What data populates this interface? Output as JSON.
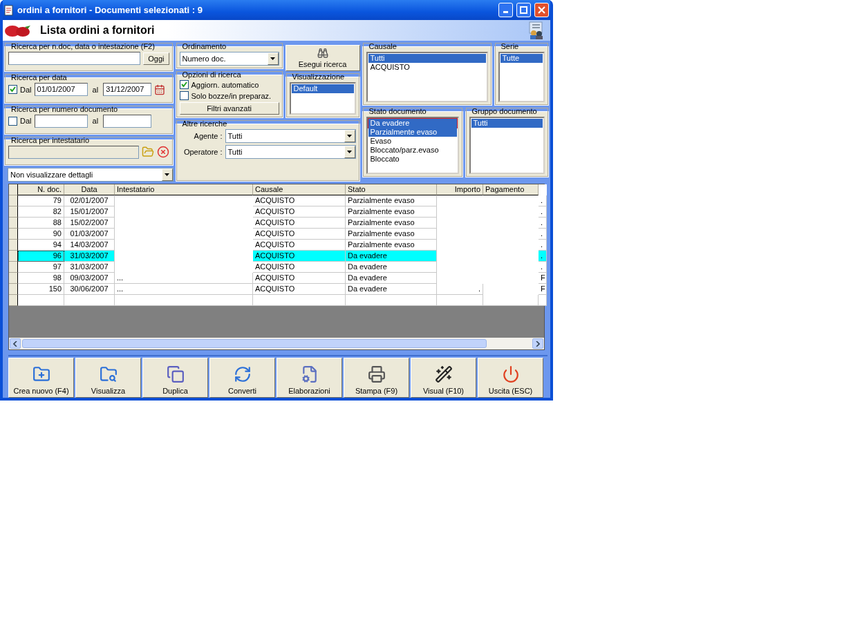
{
  "window": {
    "title": "ordini a fornitori - Documenti selezionati : 9"
  },
  "header": {
    "title": "Lista ordini a fornitori"
  },
  "text_search": {
    "label": "Ricerca per n.doc, data o intestazione (F2)",
    "button": "Oggi"
  },
  "date_search": {
    "label": "Ricerca per data",
    "checked": true,
    "from_label": "Dal",
    "from": "01/01/2007",
    "to_label": "al",
    "to": "31/12/2007"
  },
  "number_search": {
    "label": "Ricerca per numero documento",
    "checked": false,
    "from_label": "Dal",
    "to_label": "al"
  },
  "holder_search": {
    "label": "Ricerca per intestatario"
  },
  "details_select": {
    "value": "Non visualizzare dettagli"
  },
  "ordering": {
    "label": "Ordinamento",
    "value": "Numero doc."
  },
  "search_options": {
    "label": "Opzioni di ricerca",
    "items": [
      {
        "label": "Aggiorn. automatico",
        "checked": true
      },
      {
        "label": "Solo bozze/in preparaz.",
        "checked": false
      }
    ],
    "button": "Filtri avanzati"
  },
  "search_button": "Esegui ricerca",
  "display": {
    "label": "Visualizzazione",
    "items": [
      {
        "label": "Default",
        "selected": true
      }
    ]
  },
  "other_searches": {
    "label": "Altre ricerche",
    "fields": [
      {
        "label": "Agente :",
        "value": "Tutti"
      },
      {
        "label": "Operatore :",
        "value": "Tutti"
      }
    ]
  },
  "causale": {
    "label": "Causale",
    "items": [
      {
        "label": "Tutti",
        "selected": true
      },
      {
        "label": "ACQUISTO",
        "selected": false
      }
    ]
  },
  "serie": {
    "label": "Serie",
    "items": [
      {
        "label": "Tutte",
        "selected": true
      }
    ]
  },
  "document_state": {
    "label": "Stato documento",
    "items": [
      {
        "label": "Da evadere",
        "selected": true,
        "outlined": true
      },
      {
        "label": "Parzialmente evaso",
        "selected": true,
        "outlined": false
      },
      {
        "label": "Evaso",
        "selected": false,
        "outlined": false
      },
      {
        "label": "Bloccato/parz.evaso",
        "selected": false,
        "outlined": false
      },
      {
        "label": "Bloccato",
        "selected": false,
        "outlined": false
      }
    ]
  },
  "document_group": {
    "label": "Gruppo documento",
    "items": [
      {
        "label": "Tutti",
        "selected": true
      }
    ]
  },
  "table": {
    "columns": [
      {
        "label": "N. doc."
      },
      {
        "label": "Data"
      },
      {
        "label": "Intestatario"
      },
      {
        "label": "Causale"
      },
      {
        "label": "Stato"
      },
      {
        "label": "Importo"
      },
      {
        "label": "Pagamento"
      }
    ],
    "rows": [
      {
        "selected": false,
        "cells": [
          "79",
          "02/01/2007",
          null,
          "ACQUISTO",
          "Parzialmente evaso",
          null,
          null,
          "."
        ]
      },
      {
        "selected": false,
        "cells": [
          "82",
          "15/01/2007",
          null,
          "ACQUISTO",
          "Parzialmente evaso",
          null,
          null,
          "."
        ]
      },
      {
        "selected": false,
        "cells": [
          "88",
          "15/02/2007",
          null,
          "ACQUISTO",
          "Parzialmente evaso",
          null,
          null,
          "."
        ]
      },
      {
        "selected": false,
        "cells": [
          "90",
          "01/03/2007",
          null,
          "ACQUISTO",
          "Parzialmente evaso",
          null,
          null,
          "."
        ]
      },
      {
        "selected": false,
        "cells": [
          "94",
          "14/03/2007",
          null,
          "ACQUISTO",
          "Parzialmente evaso",
          null,
          null,
          "."
        ]
      },
      {
        "selected": true,
        "cells": [
          "96",
          "31/03/2007",
          null,
          "ACQUISTO",
          "Da evadere",
          null,
          null,
          "."
        ]
      },
      {
        "selected": false,
        "cells": [
          "97",
          "31/03/2007",
          null,
          "ACQUISTO",
          "Da evadere",
          null,
          null,
          "."
        ]
      },
      {
        "selected": false,
        "cells": [
          "98",
          "09/03/2007",
          "...",
          "ACQUISTO",
          "Da evadere",
          null,
          null,
          "F"
        ]
      },
      {
        "selected": false,
        "cells": [
          "150",
          "30/06/2007",
          "...",
          "ACQUISTO",
          "Da evadere",
          ".",
          null,
          "F"
        ]
      }
    ]
  },
  "toolbar": [
    "Crea nuovo (F4)",
    "Visualizza",
    "Duplica",
    "Converti",
    "Elaborazioni",
    "Stampa (F9)",
    "Visual (F10)",
    "Uscita (ESC)"
  ]
}
